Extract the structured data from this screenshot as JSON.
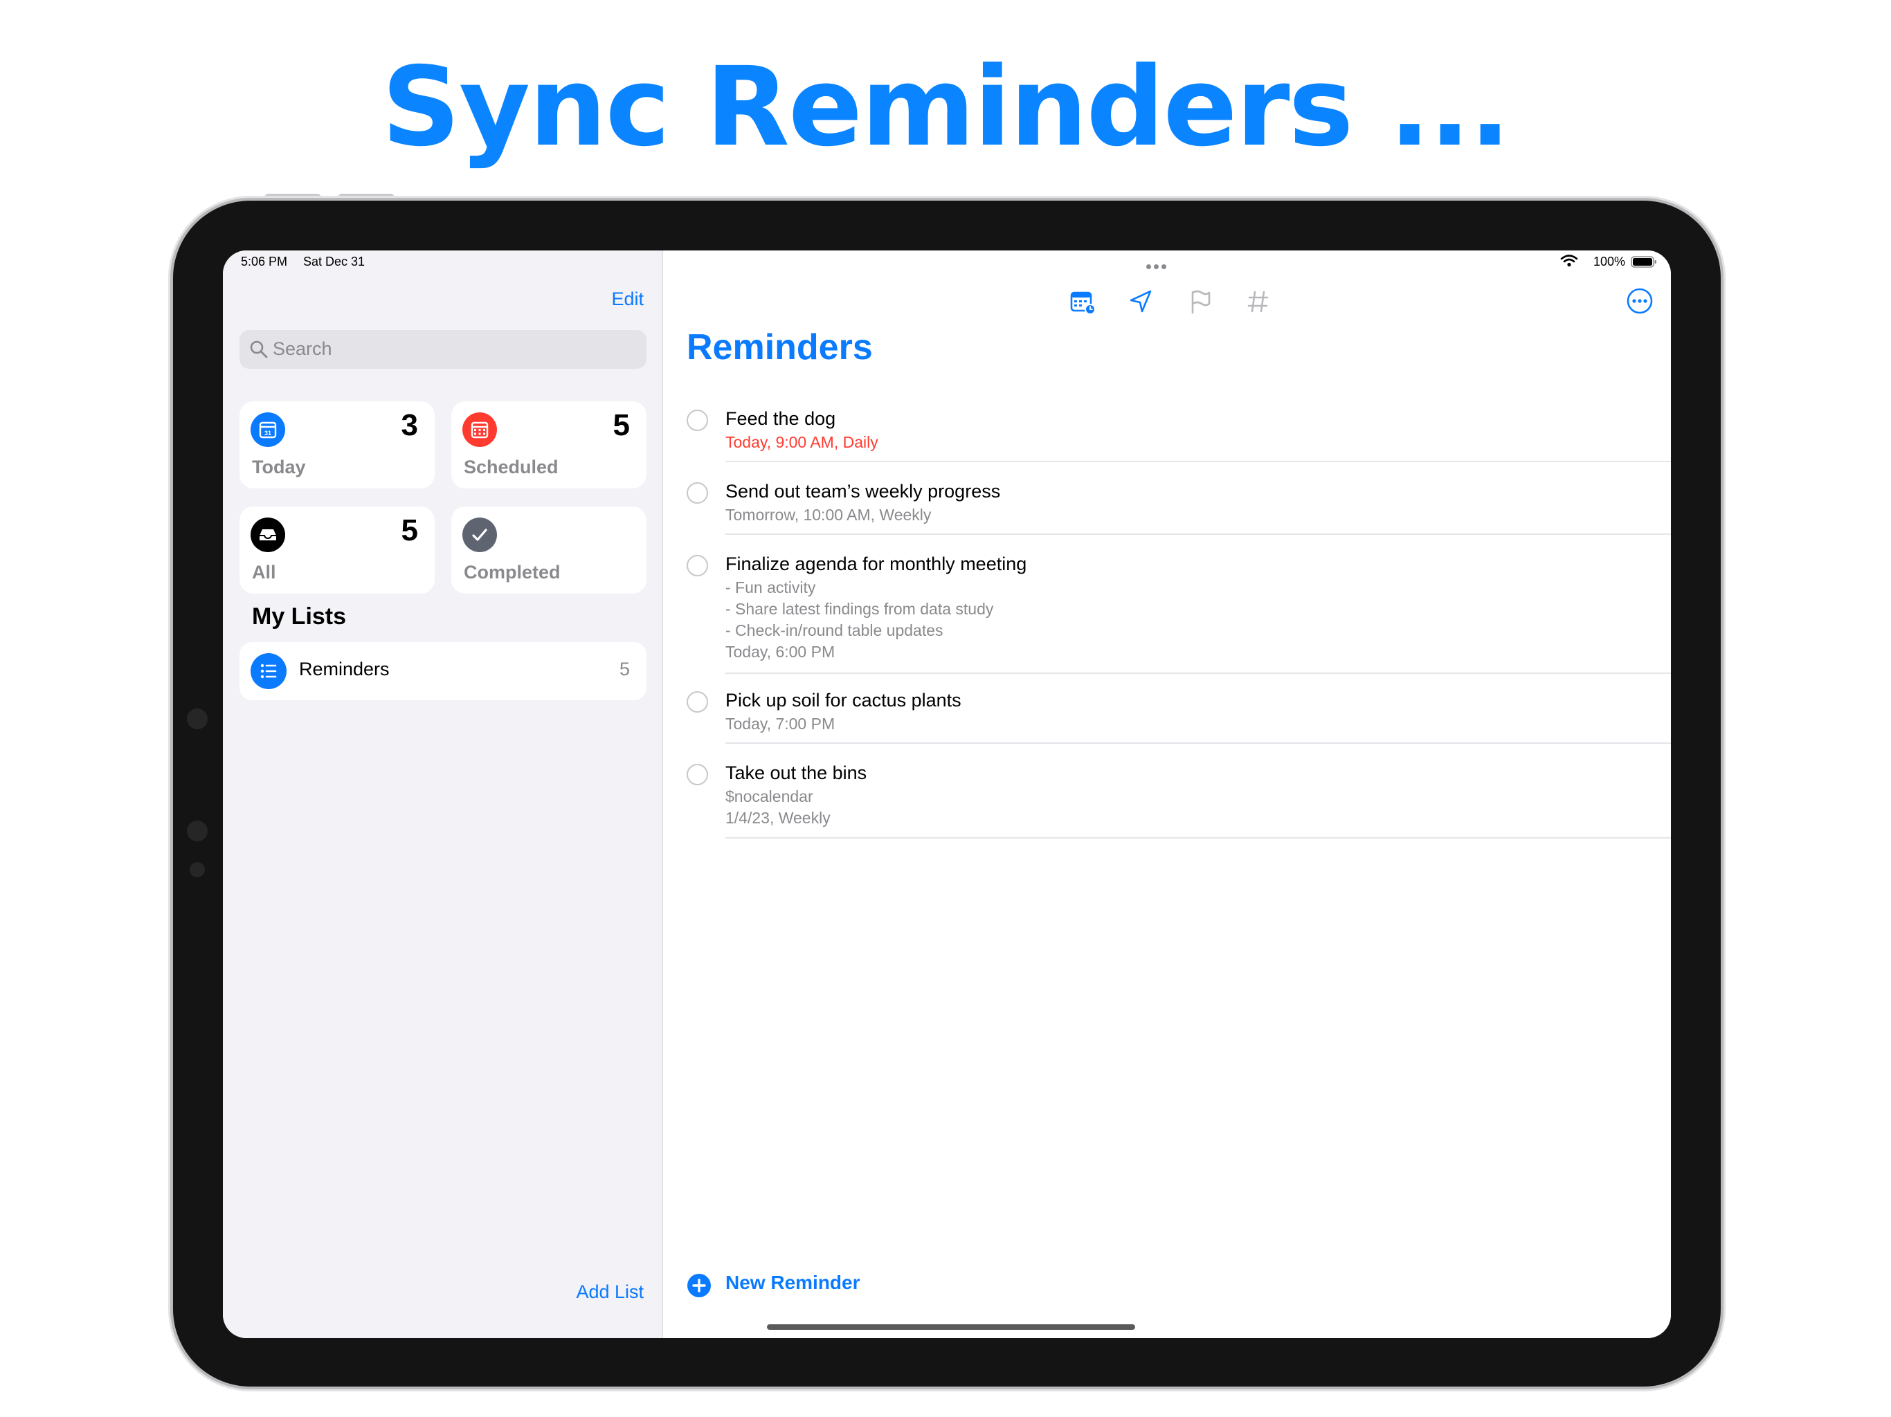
{
  "headline": "Sync Reminders ...",
  "status_bar": {
    "time": "5:06 PM",
    "date": "Sat Dec 31",
    "battery": "100%"
  },
  "sidebar": {
    "edit_label": "Edit",
    "search_placeholder": "Search",
    "smart_lists": [
      {
        "label": "Today",
        "count": "3",
        "icon": "calendar-today-icon",
        "color": "#0a7aff"
      },
      {
        "label": "Scheduled",
        "count": "5",
        "icon": "calendar-scheduled-icon",
        "color": "#ff3b30"
      },
      {
        "label": "All",
        "count": "5",
        "icon": "tray-icon",
        "color": "#000000"
      },
      {
        "label": "Completed",
        "count": "",
        "icon": "checkmark-icon",
        "color": "#5e6570"
      }
    ],
    "my_lists_heading": "My Lists",
    "lists": [
      {
        "name": "Reminders",
        "count": "5",
        "icon": "list-bullet-icon",
        "color": "#0a7aff"
      }
    ],
    "add_list_label": "Add List"
  },
  "main": {
    "toolbar": [
      "calendar-icon",
      "location-icon",
      "flag-icon",
      "hashtag-icon"
    ],
    "more_icon": "ellipsis-circle-icon",
    "title": "Reminders",
    "reminders": [
      {
        "title": "Feed the dog",
        "details": [
          "Today, 9:00 AM, Daily"
        ],
        "overdue": true
      },
      {
        "title": "Send out team’s weekly progress",
        "details": [
          "Tomorrow, 10:00 AM, Weekly"
        ]
      },
      {
        "title": "Finalize agenda for monthly meeting",
        "details": [
          "- Fun activity",
          "- Share latest findings from data study",
          "- Check-in/round table updates",
          "Today, 6:00 PM"
        ]
      },
      {
        "title": "Pick up soil for cactus plants",
        "details": [
          "Today, 7:00 PM"
        ]
      },
      {
        "title": "Take out the bins",
        "details": [
          "$nocalendar",
          "1/4/23, Weekly"
        ]
      }
    ],
    "new_reminder_label": "New Reminder"
  },
  "colors": {
    "accent": "#0a7aff",
    "overdue": "#ff3b30"
  }
}
